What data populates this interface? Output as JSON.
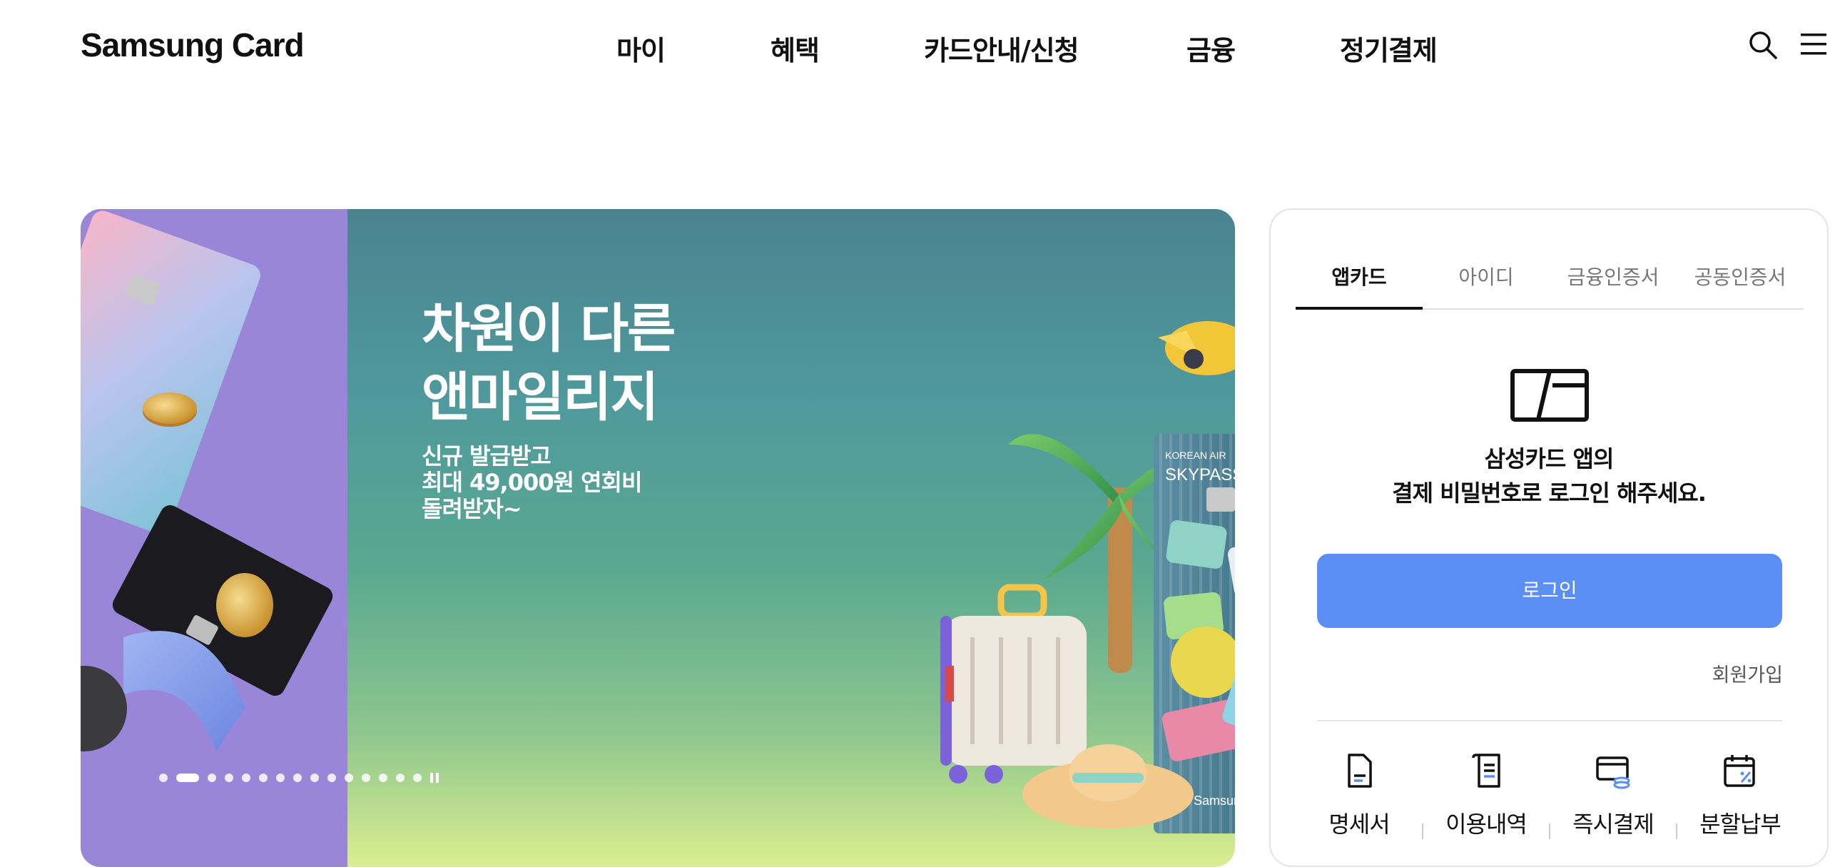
{
  "header": {
    "logo": "Samsung Card",
    "nav": [
      "마이",
      "혜택",
      "카드안내/신청",
      "금융",
      "정기결제"
    ],
    "search_icon": "search-icon",
    "menu_icon": "menu-icon"
  },
  "banner": {
    "title_line1": "차원이 다른",
    "title_line2": "앤마일리지",
    "sub_line1": "신규 발급받고",
    "sub_line2": "최대 49,000원 연회비",
    "sub_line3": "돌려받자~",
    "card_brand": "KOREAN AIR",
    "card_name": "SKYPASS",
    "card_issuer": "Samsung Card",
    "slide_count": 15,
    "active_slide": 2,
    "colors": {
      "left_panel": "#9a86d8",
      "gradient_top": "#4a8390",
      "gradient_bottom": "#dbee90"
    }
  },
  "login": {
    "tabs": [
      "앱카드",
      "아이디",
      "금융인증서",
      "공동인증서"
    ],
    "active_tab": 0,
    "desc_line1": "삼성카드 앱의",
    "desc_line2": "결제 비밀번호로 로그인 해주세요.",
    "login_label": "로그인",
    "signup_label": "회원가입",
    "quick": [
      {
        "label": "명세서",
        "icon": "statement-icon"
      },
      {
        "label": "이용내역",
        "icon": "usage-history-icon"
      },
      {
        "label": "즉시결제",
        "icon": "instant-payment-icon"
      },
      {
        "label": "분할납부",
        "icon": "installment-calendar-icon"
      }
    ],
    "accent_color": "#5b8ff5"
  }
}
